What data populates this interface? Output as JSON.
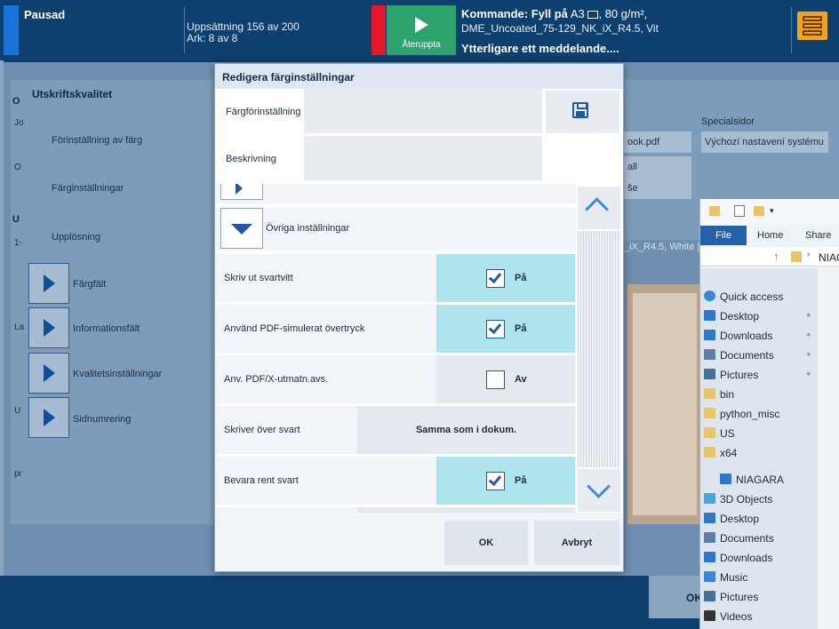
{
  "topbar": {
    "status": "Pausad",
    "setup_line1": "Uppsättning 156 av 200",
    "setup_line2": "Ark: 8 av 8",
    "resume_label": "Återuppta",
    "command_prefix": "Kommande: Fyll på",
    "command_media": "A3",
    "command_weight": ", 80 g/m²,",
    "command_line2": "DME_Uncoated_75-129_NK_iX_R4.5, Vit",
    "command_line3": "Ytterligare ett meddelande....",
    "menu_icon": "menu-icon"
  },
  "background": {
    "left_title": "Utskriftskvalitet",
    "items": [
      "Förinställning av färg",
      "Färginställningar",
      "Upplösning"
    ],
    "expanders": [
      "Färgfält",
      "Informationsfält",
      "Kvalitetsinställningar",
      "Sidnumrering"
    ],
    "special_header": "Specialsidor",
    "special_value": "Výchozí nastavení systému",
    "file_field": "ook.pdf",
    "field2": "all",
    "field3": "še",
    "media_text": "_iX_R4.5, White |",
    "ok_label": "OK",
    "left_letters": [
      "O",
      "Jo",
      "O",
      "U",
      "1-",
      "La",
      "U",
      "pr"
    ]
  },
  "explorer": {
    "tabs": [
      "File",
      "Home",
      "Share"
    ],
    "address": "NIAGA",
    "quick_access": "Quick access",
    "quick_items": [
      "Desktop",
      "Downloads",
      "Documents",
      "Pictures",
      "bin",
      "python_misc",
      "US",
      "x64"
    ],
    "pc_name": "NIAGARA",
    "pc_items": [
      "3D Objects",
      "Desktop",
      "Documents",
      "Downloads",
      "Music",
      "Pictures",
      "Videos"
    ]
  },
  "dialog": {
    "title": "Redigera färginställningar",
    "preset_label": "Färgförinställning",
    "preset_value": "",
    "description_label": "Beskrivning",
    "description_value": "",
    "save_icon": "save-icon",
    "section_label": "Övriga inställningar",
    "rows": [
      {
        "label": "Skriv ut svartvitt",
        "checked": true,
        "value": "På"
      },
      {
        "label": "Använd PDF-simulerat övertryck",
        "checked": true,
        "value": "På"
      },
      {
        "label": "Anv. PDF/X-utmatn.avs.",
        "checked": false,
        "value": "Av"
      },
      {
        "label": "Skriver över svart",
        "select": "Samma som i dokum."
      },
      {
        "label": "Bevara rent svart",
        "checked": true,
        "value": "På"
      }
    ],
    "ok_label": "OK",
    "cancel_label": "Avbryt"
  }
}
